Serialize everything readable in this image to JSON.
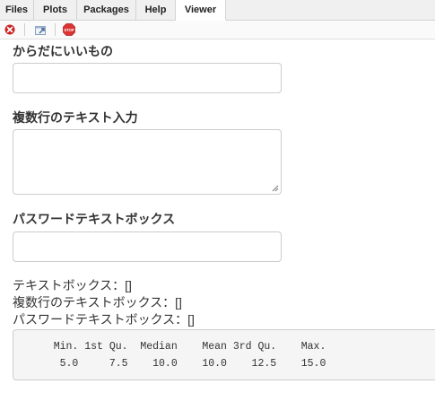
{
  "tabs": [
    {
      "label": "Files",
      "active": false
    },
    {
      "label": "Plots",
      "active": false
    },
    {
      "label": "Packages",
      "active": false
    },
    {
      "label": "Help",
      "active": false
    },
    {
      "label": "Viewer",
      "active": true
    }
  ],
  "toolbar": {
    "remove_icon": "remove-viewer-icon",
    "popout_icon": "show-in-new-window-icon",
    "stop_icon": "stop-icon",
    "stop_label": "STOP",
    "colors": {
      "remove": "#cc2222",
      "stop": "#dd3333"
    }
  },
  "form": {
    "text_label": "からだにいいもの",
    "text_value": "",
    "textarea_label": "複数行のテキスト入力",
    "textarea_value": "",
    "password_label": "パスワードテキストボックス",
    "password_value": ""
  },
  "outputs": {
    "text_line": "テキストボックス：[]",
    "textarea_line": "複数行のテキストボックス：[]",
    "password_line": "パスワードテキストボックス：[]"
  },
  "summary": {
    "header": "   Min. 1st Qu.  Median    Mean 3rd Qu.    Max. ",
    "values": "    5.0     7.5    10.0    10.0    12.5    15.0 "
  }
}
